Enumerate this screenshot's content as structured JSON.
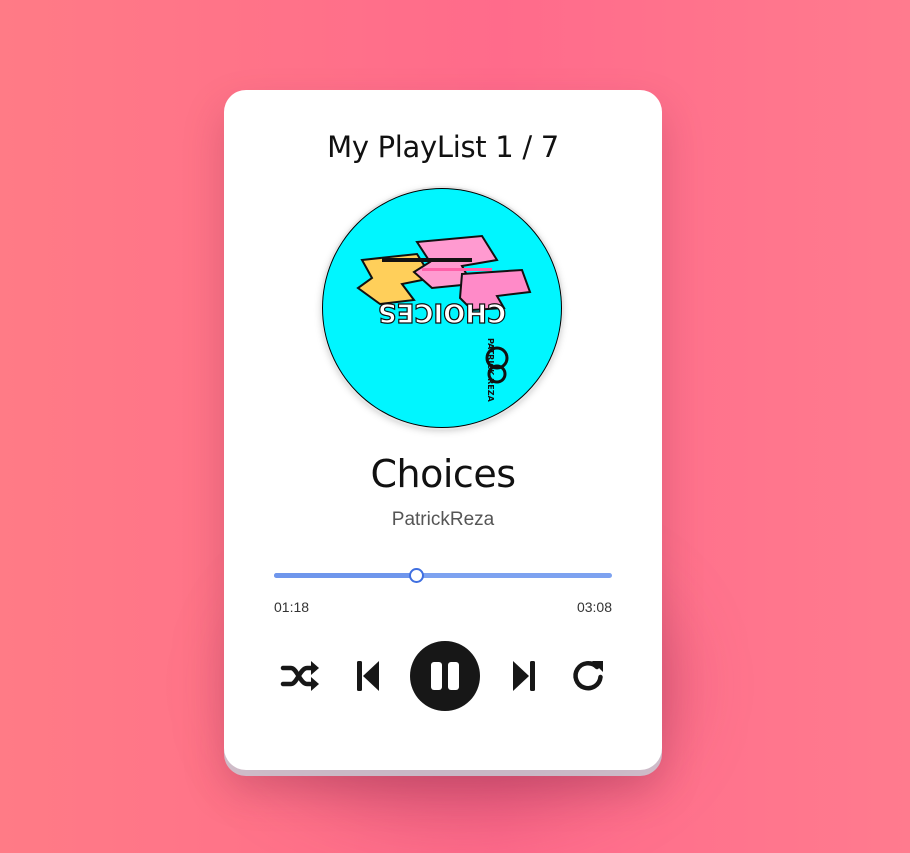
{
  "player": {
    "playlist_label": "My PlayList",
    "track_position": "1 / 7",
    "song_title": "Choices",
    "artist": "PatrickReza",
    "cover": {
      "art_text": "CHOICES",
      "logo_text": "PATRICK REZA",
      "background_color": "#00f6ff"
    },
    "progress": {
      "current_time": "01:18",
      "total_time": "03:08",
      "fraction": 0.42
    },
    "controls": {
      "shuffle": "shuffle-icon",
      "previous": "skip-previous-icon",
      "play_pause": "pause-icon",
      "next": "skip-next-icon",
      "repeat": "repeat-icon"
    }
  },
  "colors": {
    "background": "#ff6b8b",
    "card": "#ffffff",
    "accent": "#6f96ec",
    "control": "#171717"
  }
}
